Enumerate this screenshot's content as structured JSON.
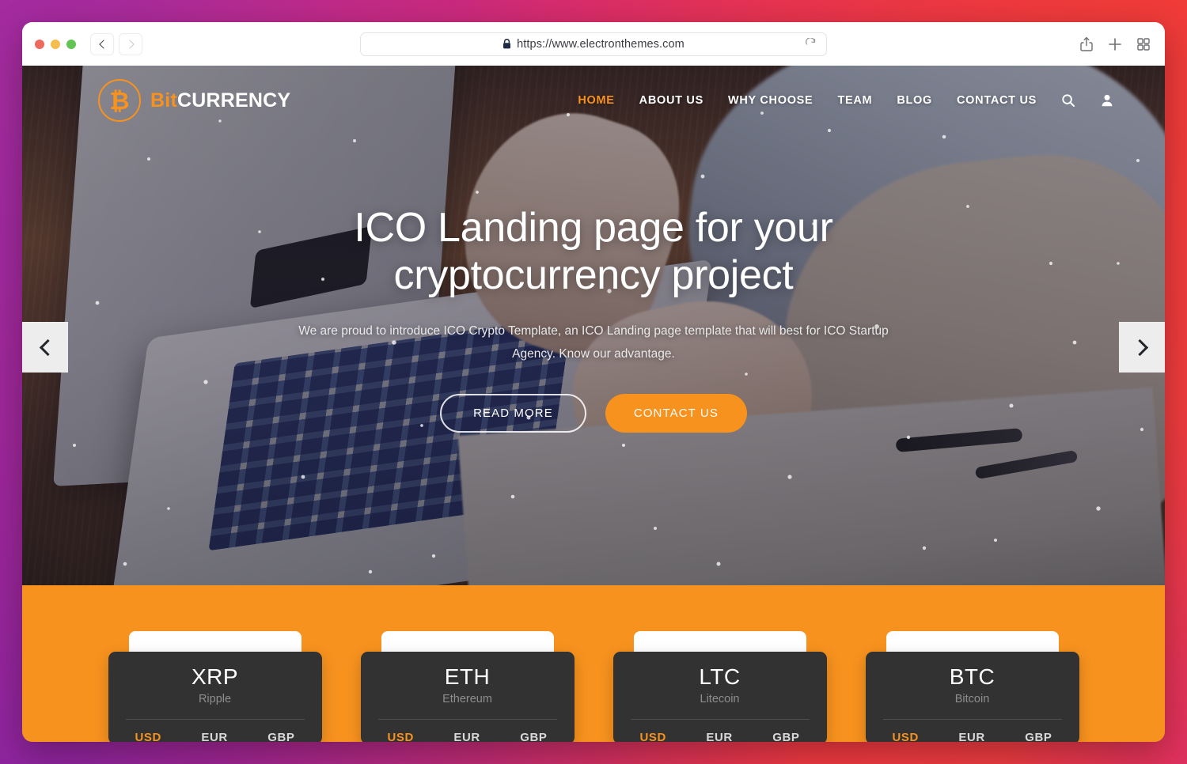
{
  "browser": {
    "window_controls": [
      "close",
      "minimize",
      "maximize"
    ],
    "back_label": "Back",
    "forward_label": "Forward",
    "url": "https://www.electronthemes.com",
    "secure_icon": "lock-icon",
    "reload_icon": "reload-icon",
    "toolbar_icons": [
      "share-icon",
      "new-tab-icon",
      "tab-overview-icon"
    ]
  },
  "site": {
    "logo": {
      "mark": "₿",
      "bit": "Bit",
      "currency": "CURRENCY"
    },
    "nav": [
      {
        "label": "HOME",
        "active": true
      },
      {
        "label": "ABOUT US",
        "active": false
      },
      {
        "label": "WHY CHOOSE",
        "active": false
      },
      {
        "label": "TEAM",
        "active": false
      },
      {
        "label": "BLOG",
        "active": false
      },
      {
        "label": "CONTACT US",
        "active": false
      }
    ],
    "nav_icons": [
      "search-icon",
      "user-account-icon"
    ],
    "accent_color": "#f7921e",
    "dark_card_color": "#323232"
  },
  "hero": {
    "title": "ICO Landing page for your cryptocurrency project",
    "subtitle": "We are proud to introduce ICO Crypto Template, an ICO Landing page template that will best for ICO Startup Agency. Know our advantage.",
    "primary_button": "READ MORE",
    "secondary_button": "CONTACT US",
    "prev_arrow": "‹",
    "next_arrow": "›"
  },
  "prices": {
    "currency_tabs": [
      "USD",
      "EUR",
      "GBP"
    ],
    "active_tab": "USD",
    "cards": [
      {
        "symbol": "XRP",
        "name": "Ripple"
      },
      {
        "symbol": "ETH",
        "name": "Ethereum"
      },
      {
        "symbol": "LTC",
        "name": "Litecoin"
      },
      {
        "symbol": "BTC",
        "name": "Bitcoin"
      }
    ]
  }
}
